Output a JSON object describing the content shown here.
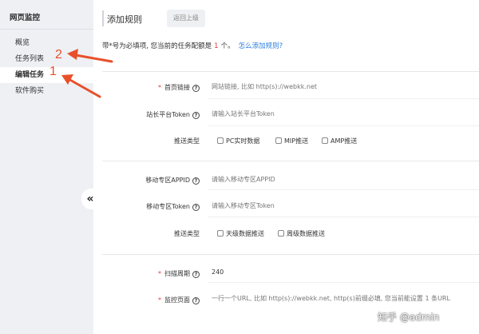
{
  "sidebar": {
    "title": "网页监控",
    "items": [
      {
        "label": "概览"
      },
      {
        "label": "任务列表"
      },
      {
        "label": "编辑任务"
      },
      {
        "label": "软件购买"
      }
    ],
    "collapse_glyph": "«"
  },
  "annotations": [
    {
      "number": "2"
    },
    {
      "number": "1"
    }
  ],
  "header": {
    "title": "添加规则",
    "back_label": "返回上级"
  },
  "notice": {
    "text_before": "带*号为必填项, 您当前的任务配额是",
    "quota": "1",
    "text_after": "个。",
    "link": "怎么添加规则?"
  },
  "form": {
    "homepage": {
      "label": "首页链接",
      "placeholder": "网站链接, 比如 http(s)://webkk.net"
    },
    "site_token": {
      "label": "站长平台Token",
      "placeholder": "请输入站长平台Token"
    },
    "push_type": {
      "label": "推送类型",
      "options": [
        "PC实时数据",
        "MIP推送",
        "AMP推送"
      ]
    },
    "mobile_appid": {
      "label": "移动专区APPID",
      "placeholder": "请输入移动专区APPID"
    },
    "mobile_token": {
      "label": "移动专区Token",
      "placeholder": "请输入移动专区Token"
    },
    "push_type_2": {
      "label": "推送类型",
      "options": [
        "天级数据推送",
        "周级数据推送"
      ]
    },
    "scan_period": {
      "label": "扫描周期",
      "value": "240"
    },
    "monitor_pages": {
      "label": "监控页面",
      "placeholder": "一行一个URL, 比如 http(s)://webkk.net, http(s)前缀必填, 您当前能设置 1 条URL"
    }
  },
  "watermark": "知乎 @admin",
  "colors": {
    "sidebar_bg": "#eef0f4",
    "required": "#e03c3c",
    "link": "#2b7de1",
    "annotation": "#e8502a"
  }
}
